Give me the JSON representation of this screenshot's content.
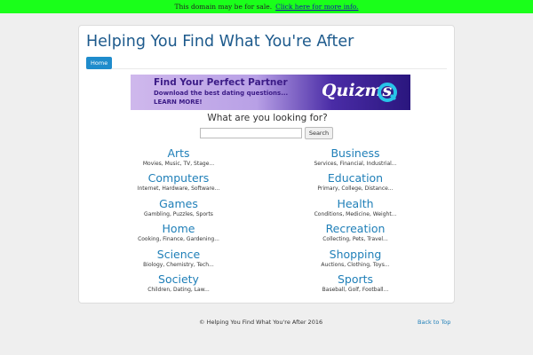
{
  "sale_banner": {
    "text": "This domain may be for sale.",
    "link": "Click here for more info."
  },
  "header": {
    "title": "Helping You Find What You're After",
    "nav_home": "Home"
  },
  "ad": {
    "line1": "Find Your Perfect Partner",
    "line2": "Download the best dating questions...",
    "line3": "LEARN MORE!",
    "logo": "Quizms"
  },
  "search": {
    "heading": "What are you looking for?",
    "value": "",
    "button": "Search"
  },
  "categories": [
    {
      "title": "Arts",
      "sub": "Movies, Music, TV, Stage..."
    },
    {
      "title": "Business",
      "sub": "Services, Financial, Industrial..."
    },
    {
      "title": "Computers",
      "sub": "Internet, Hardware, Software..."
    },
    {
      "title": "Education",
      "sub": "Primary, College, Distance..."
    },
    {
      "title": "Games",
      "sub": "Gambling, Puzzles, Sports"
    },
    {
      "title": "Health",
      "sub": "Conditions, Medicine, Weight..."
    },
    {
      "title": "Home",
      "sub": "Cooking, Finance, Gardening..."
    },
    {
      "title": "Recreation",
      "sub": "Collecting, Pets, Travel..."
    },
    {
      "title": "Science",
      "sub": "Biology, Chemistry, Tech..."
    },
    {
      "title": "Shopping",
      "sub": "Auctions, Clothing, Toys..."
    },
    {
      "title": "Society",
      "sub": "Children, Dating, Law..."
    },
    {
      "title": "Sports",
      "sub": "Baseball, Golf, Football..."
    }
  ],
  "footer": {
    "copyright": "© Helping You Find What You're After 2016",
    "back_to_top": "Back to Top"
  },
  "colors": {
    "sale_bar": "#1aff1a",
    "link_blue": "#1f7fb8",
    "title_blue": "#1d5a8c",
    "nav_button": "#1f8ccc"
  }
}
